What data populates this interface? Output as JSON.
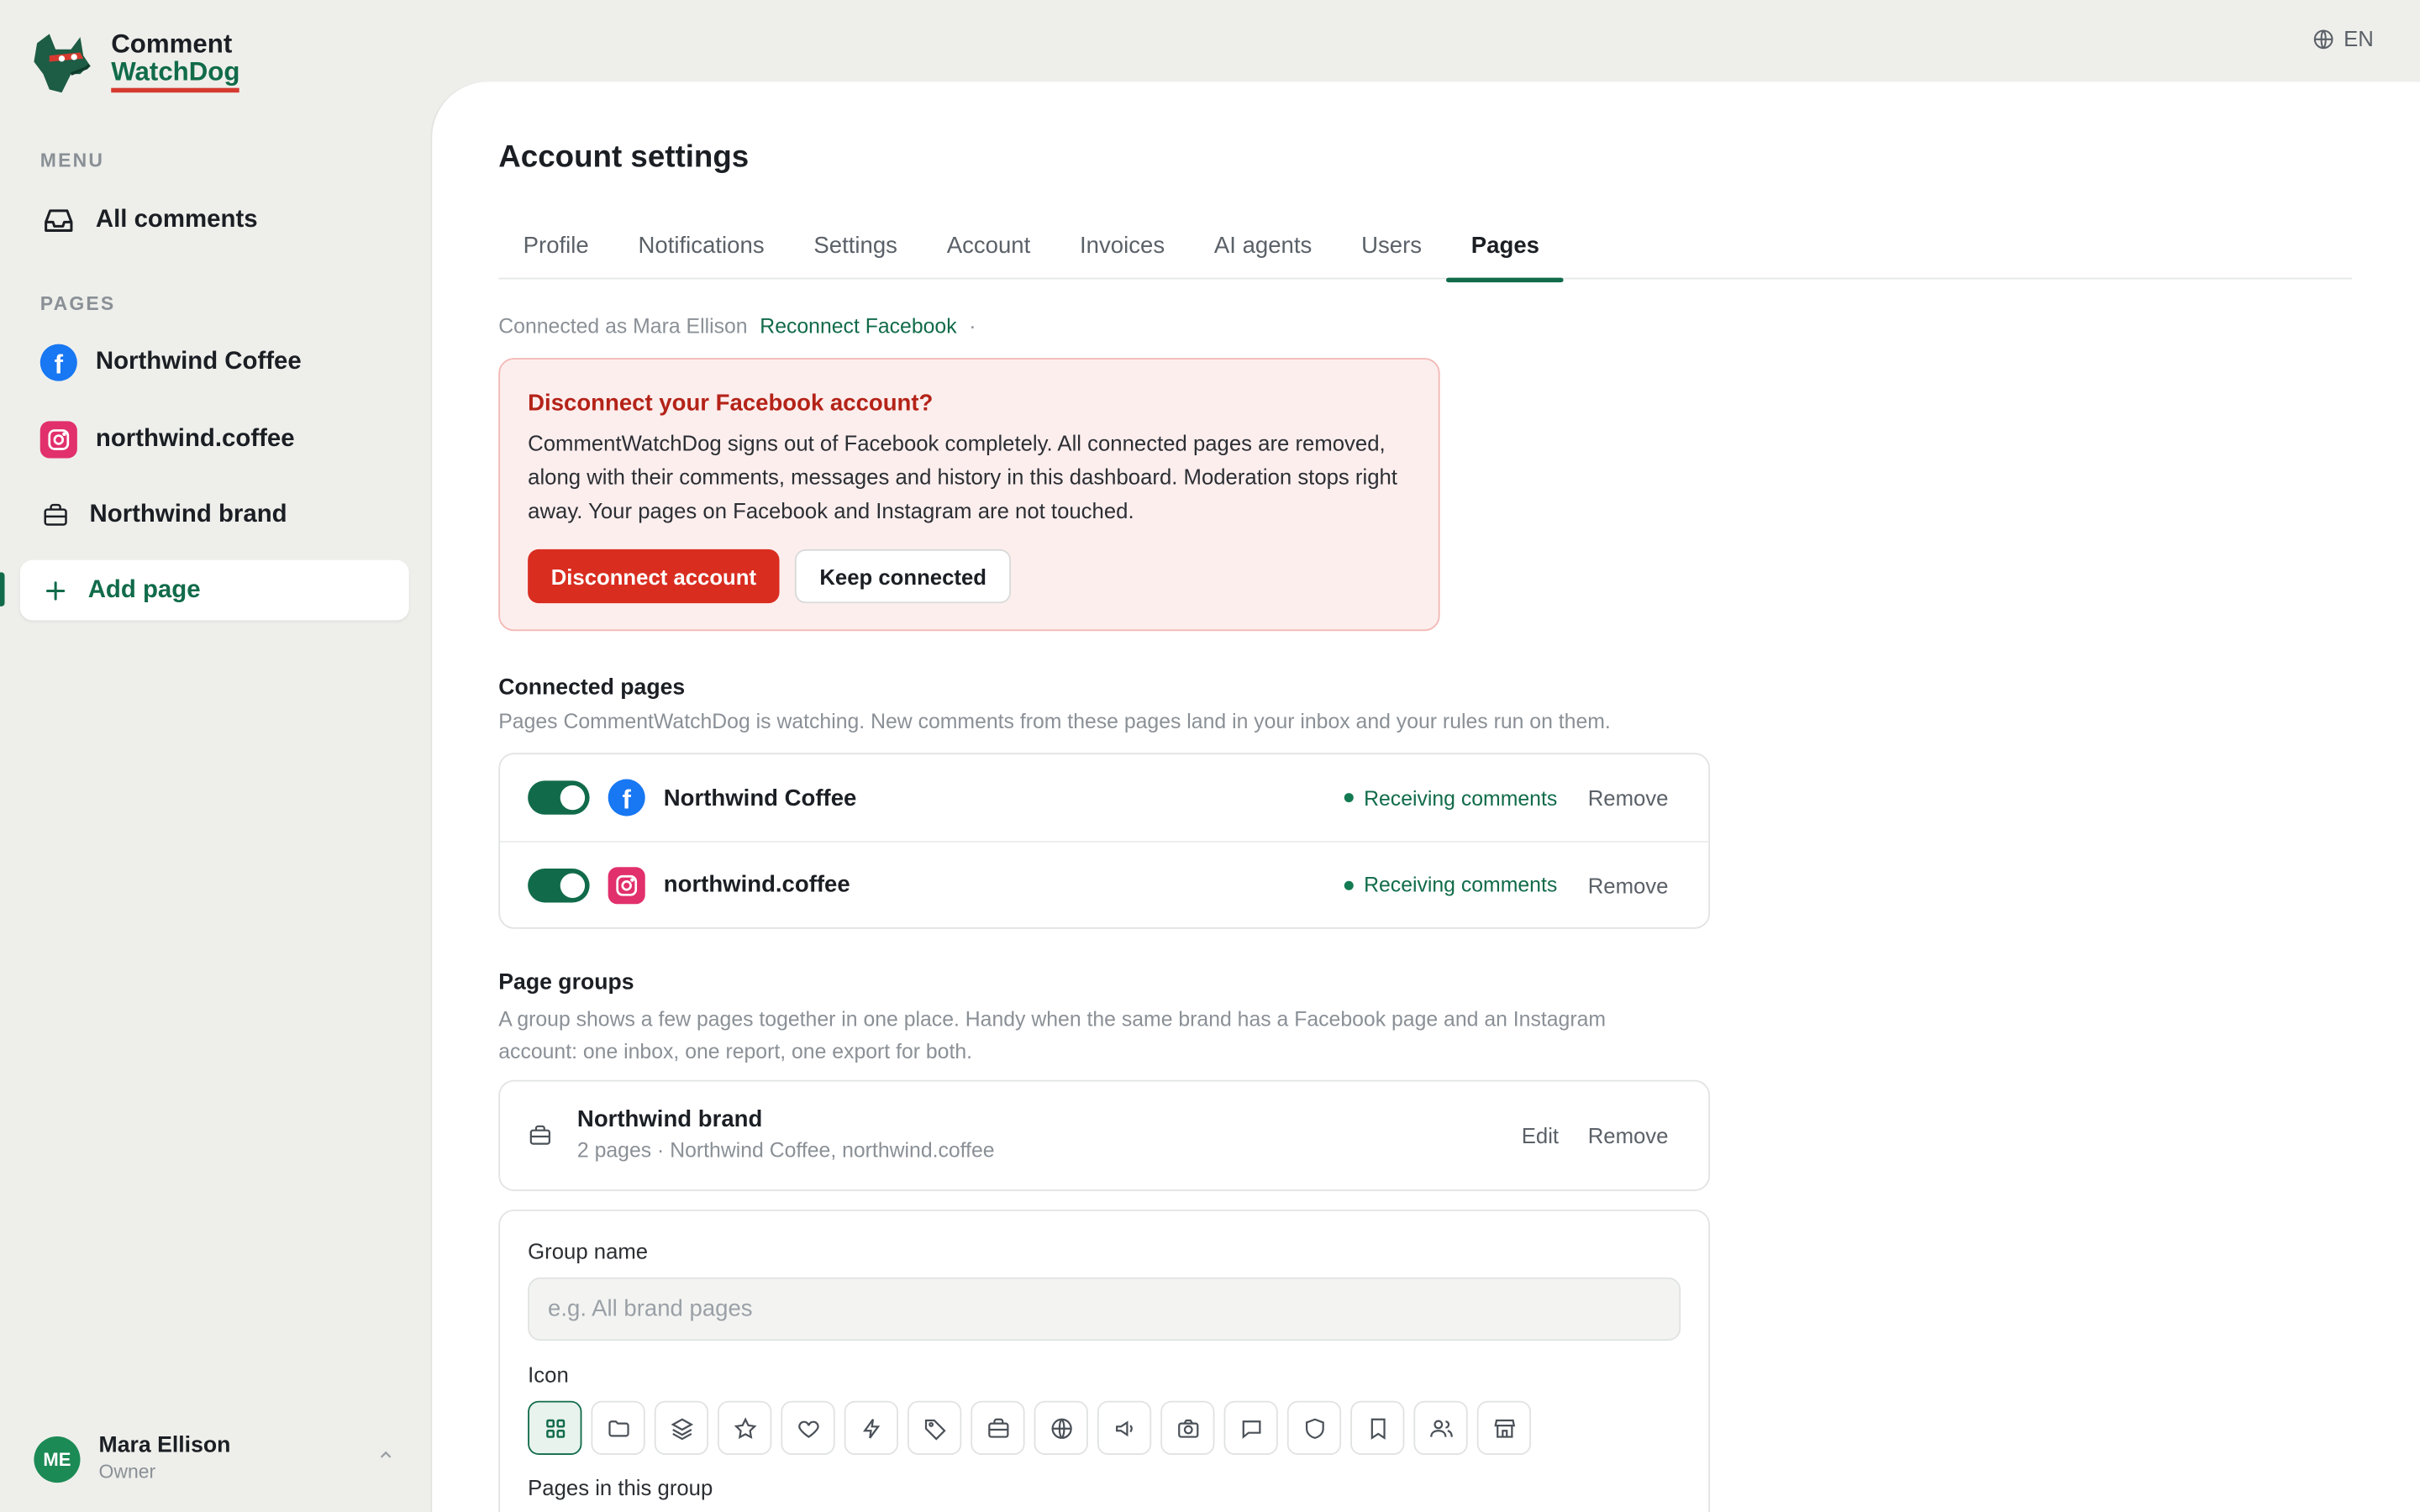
{
  "brand": {
    "line1": "Comment",
    "line2": "WatchDog"
  },
  "language": "EN",
  "sidebar": {
    "menu_label": "MENU",
    "all_comments": "All comments",
    "pages_label": "PAGES",
    "pages": [
      {
        "label": "Northwind Coffee",
        "type": "facebook"
      },
      {
        "label": "northwind.coffee",
        "type": "instagram"
      },
      {
        "label": "Northwind brand",
        "type": "group"
      }
    ],
    "add_page": "Add page"
  },
  "user": {
    "initials": "ME",
    "name": "Mara Ellison",
    "role": "Owner"
  },
  "page_title": "Account settings",
  "tabs": [
    "Profile",
    "Notifications",
    "Settings",
    "Account",
    "Invoices",
    "AI agents",
    "Users",
    "Pages"
  ],
  "active_tab": "Pages",
  "connection": {
    "text": "Connected as Mara Ellison",
    "reconnect": "Reconnect Facebook",
    "separator": "·"
  },
  "alert": {
    "title": "Disconnect your Facebook account?",
    "body": "CommentWatchDog signs out of Facebook completely. All connected pages are removed, along with their comments, messages and history in this dashboard. Moderation stops right away. Your pages on Facebook and Instagram are not touched.",
    "confirm": "Disconnect account",
    "cancel": "Keep connected"
  },
  "connected_pages": {
    "title": "Connected pages",
    "description": "Pages CommentWatchDog is watching. New comments from these pages land in your inbox and your rules run on them.",
    "rows": [
      {
        "name": "Northwind Coffee",
        "status": "Receiving comments",
        "action": "Remove"
      },
      {
        "name": "northwind.coffee",
        "status": "Receiving comments",
        "action": "Remove"
      }
    ]
  },
  "page_groups": {
    "title": "Page groups",
    "description": "A group shows a few pages together in one place. Handy when the same brand has a Facebook page and an Instagram account: one inbox, one report, one export for both.",
    "group": {
      "name": "Northwind brand",
      "meta": "2 pages · Northwind Coffee, northwind.coffee",
      "edit": "Edit",
      "remove": "Remove"
    }
  },
  "form": {
    "group_name_label": "Group name",
    "group_name_placeholder": "e.g. All brand pages",
    "group_name_value": "",
    "icon_label": "Icon",
    "icons": [
      "grid-icon",
      "folder-icon",
      "layers-icon",
      "star-icon",
      "heart-icon",
      "bolt-icon",
      "tag-icon",
      "briefcase-icon",
      "globe-icon",
      "megaphone-icon",
      "camera-icon",
      "chat-icon",
      "shield-icon",
      "bookmark-icon",
      "users-icon",
      "store-icon"
    ],
    "selected_icon": "grid-icon",
    "pages_label": "Pages in this group"
  },
  "colors": {
    "accent": "#116b4a",
    "danger": "#d92d20",
    "facebook": "#1877f2",
    "instagram": "#e1306c"
  }
}
